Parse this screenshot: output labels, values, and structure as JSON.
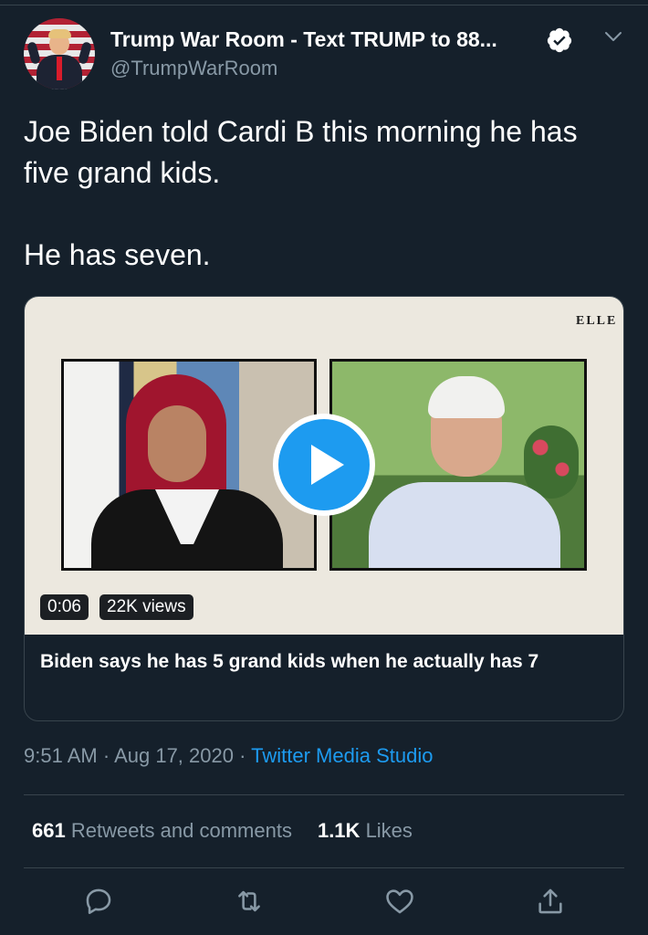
{
  "tweet": {
    "author": {
      "display_name": "Trump War Room - Text TRUMP to 88...",
      "handle": "@TrumpWarRoom",
      "verified": true
    },
    "text": "Joe Biden told Cardi B this morning he has five grand kids.\n\nHe has seven.",
    "media": {
      "brand_logo": "ELLE",
      "duration": "0:06",
      "views": "22K views",
      "title": "Biden says he has 5 grand kids when he actually has 7"
    },
    "meta": {
      "time": "9:51 AM",
      "separator": "·",
      "date": "Aug 17, 2020",
      "source": "Twitter Media Studio"
    },
    "stats": {
      "retweets_count": "661",
      "retweets_label": "Retweets and comments",
      "likes_count": "1.1K",
      "likes_label": "Likes"
    }
  },
  "icons": {
    "verified": "verified-badge-icon",
    "more": "chevron-down-icon",
    "reply": "reply-icon",
    "retweet": "retweet-icon",
    "like": "heart-icon",
    "share": "share-icon"
  },
  "colors": {
    "background": "#15202b",
    "accent": "#1d9bf0",
    "secondary_text": "#8899a6",
    "divider": "#38444d"
  }
}
